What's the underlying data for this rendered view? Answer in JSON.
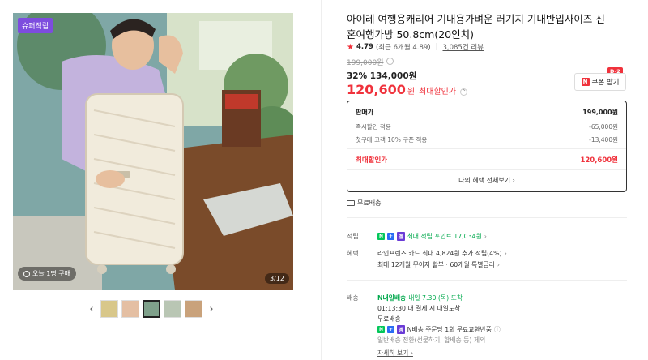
{
  "gallery": {
    "best_badge": "슈퍼적립",
    "buyers_text": "오늘 1명 구매",
    "counter": "3/12",
    "prev_arrow": "‹",
    "next_arrow": "›"
  },
  "product": {
    "title": "아이레 여행용캐리어 기내용가벼운 러기지 기내반입사이즈 신혼여행가방 50.8cm(20인치)",
    "rating": "4.79",
    "rating_detail": "(최근 6개월 4.89)",
    "reviews": "3,085건 리뷰",
    "original_price": "199,000원",
    "discount_pct": "32%",
    "sale_price": "134,000원",
    "best_price": "120,600",
    "best_unit": "원",
    "best_label": "최대할인가",
    "coupon_label": "쿠폰 받기",
    "coupon_day": "D-2"
  },
  "price_box": {
    "rows": [
      {
        "label": "판매가",
        "value": "199,000원"
      },
      {
        "label": "즉시할인 적용",
        "value": "-65,000원"
      },
      {
        "label": "첫구매 고객 10% 쿠폰 적용",
        "value": "-13,400원"
      }
    ],
    "final_label": "최대할인가",
    "final_value": "120,600원",
    "benefit_link": "나의 혜택 전체보기 ›"
  },
  "shipping_free": "무료배송",
  "points": {
    "label": "적립",
    "text": "최대 적립 포인트 17,034원"
  },
  "benefits": {
    "label": "혜택",
    "line1": "라인프렌즈 카드 최대 4,824원 추가 적립(4%)",
    "line2": "최대 12개월 무이자 할부 · 60개월 특별금리"
  },
  "delivery": {
    "label": "배송",
    "badge": "N내일배송",
    "arrival": "내일 7.30 (목) 도착",
    "cutoff": "01:13:30  내 결제 시 내일도착",
    "fee": "무료배송",
    "return_text": "N배송 주문당 1회 무료교환반품",
    "return_sub": "일반배송 전환(선물하기, 합배송 등) 제외",
    "more": "자세히 보기 ›"
  },
  "colors": {
    "accent_red": "#f0323c",
    "naver_green": "#03c75a",
    "purple": "#7d4dde"
  }
}
